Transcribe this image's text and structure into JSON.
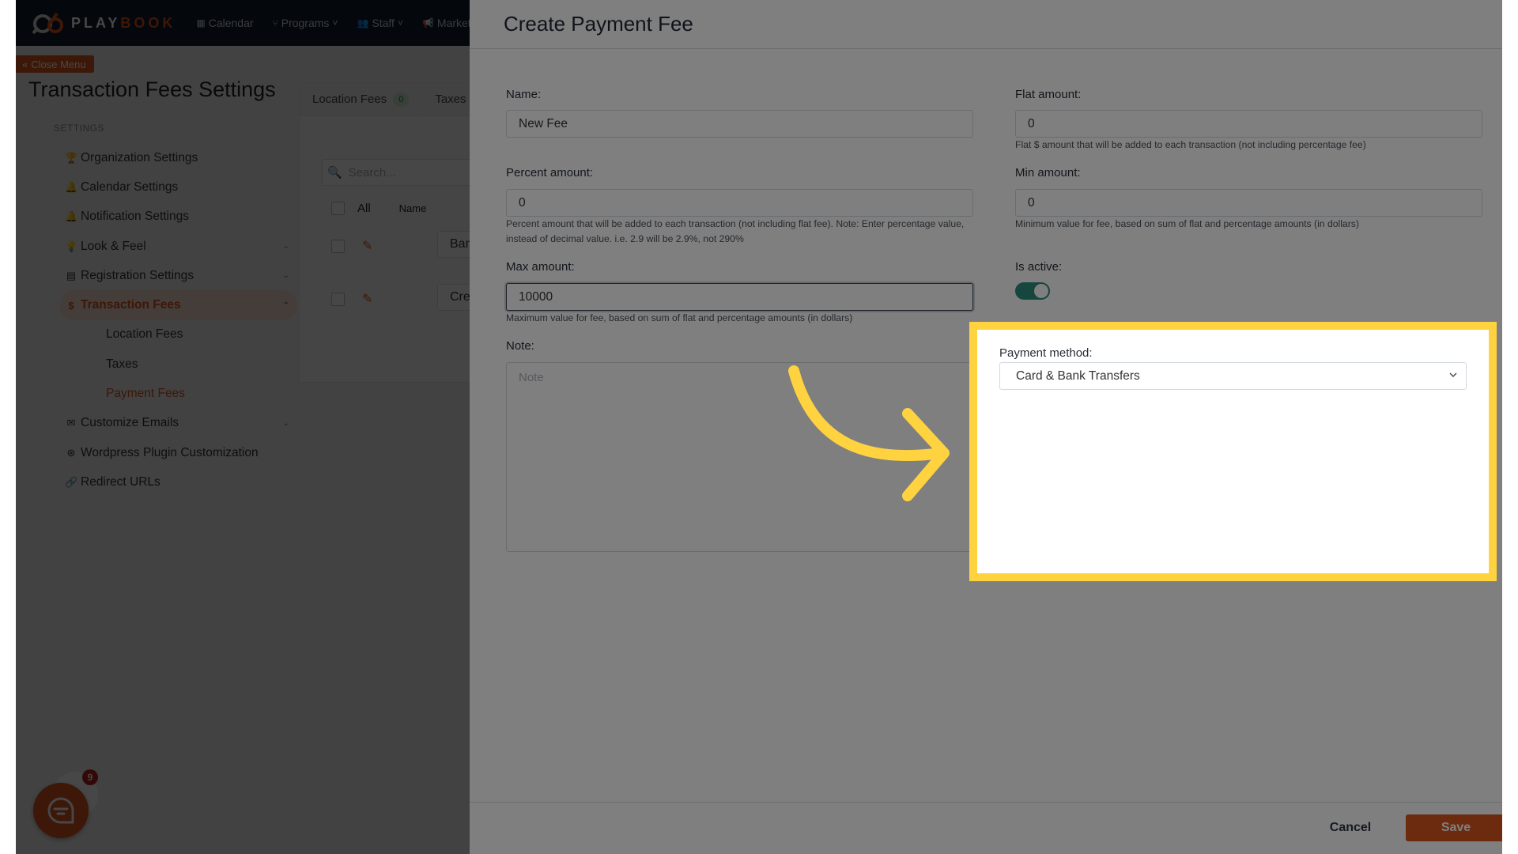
{
  "app": {
    "brand_part1": "PLAY",
    "brand_part2": "BOOK",
    "nav": [
      {
        "label": "Calendar",
        "icon": "calendar-icon"
      },
      {
        "label": "Programs",
        "icon": "branch-icon",
        "has_dropdown": true
      },
      {
        "label": "Staff",
        "icon": "users-icon",
        "has_dropdown": true
      },
      {
        "label": "Marketi",
        "icon": "megaphone-icon"
      }
    ],
    "close_menu_label": "Close Menu",
    "page_title": "Transaction Fees Settings",
    "settings_heading": "SETTINGS",
    "sidebar": [
      {
        "label": "Organization Settings",
        "icon": "trophy-icon"
      },
      {
        "label": "Calendar Settings",
        "icon": "bell-icon"
      },
      {
        "label": "Notification Settings",
        "icon": "bell-icon"
      },
      {
        "label": "Look & Feel",
        "icon": "lightbulb-icon",
        "expandable": true
      },
      {
        "label": "Registration Settings",
        "icon": "form-icon",
        "expandable": true
      },
      {
        "label": "Transaction Fees",
        "icon": "dollar-icon",
        "expandable": true,
        "active": true
      },
      {
        "label": "Location Fees",
        "sub": true
      },
      {
        "label": "Taxes",
        "sub": true
      },
      {
        "label": "Payment Fees",
        "sub": true,
        "current": true
      },
      {
        "label": "Customize Emails",
        "icon": "envelope-icon",
        "expandable": true
      },
      {
        "label": "Wordpress Plugin Customization",
        "icon": "wordpress-icon"
      },
      {
        "label": "Redirect URLs",
        "icon": "link-icon"
      }
    ],
    "tabs": [
      {
        "label": "Location Fees",
        "count": "0"
      },
      {
        "label": "Taxes"
      }
    ],
    "search_placeholder": "Search...",
    "table": {
      "select_all_label": "All",
      "name_header": "Name",
      "rows": [
        {
          "name": "Bank"
        },
        {
          "name": "Credi"
        }
      ]
    },
    "chat_badge_count": "9"
  },
  "modal": {
    "title": "Create Payment Fee",
    "fields": {
      "name": {
        "label": "Name:",
        "value": "New Fee"
      },
      "flat_amount": {
        "label": "Flat amount:",
        "value": "0",
        "help": "Flat $ amount that will be added to each transaction (not including percentage fee)"
      },
      "percent_amount": {
        "label": "Percent amount:",
        "value": "0",
        "help": "Percent amount that will be added to each transaction (not including flat fee). Note: Enter percentage value, instead of decimal value. i.e. 2.9 will be 2.9%, not 290%"
      },
      "min_amount": {
        "label": "Min amount:",
        "value": "0",
        "help": "Minimum value for fee, based on sum of flat and percentage amounts (in dollars)"
      },
      "max_amount": {
        "label": "Max amount:",
        "value": "10000",
        "help": "Maximum value for fee, based on sum of flat and percentage amounts (in dollars)"
      },
      "is_active": {
        "label": "Is active:",
        "checked": true
      },
      "note": {
        "label": "Note:",
        "placeholder": "Note",
        "value": ""
      },
      "payment_method": {
        "label": "Payment method:",
        "selected": "Card & Bank Transfers"
      }
    },
    "cancel_label": "Cancel",
    "save_label": "Save"
  },
  "colors": {
    "brand_accent": "#d9541e",
    "nav_bg": "#101c2a",
    "toggle_on": "#2e8c7d",
    "highlight": "#ffd23f"
  }
}
